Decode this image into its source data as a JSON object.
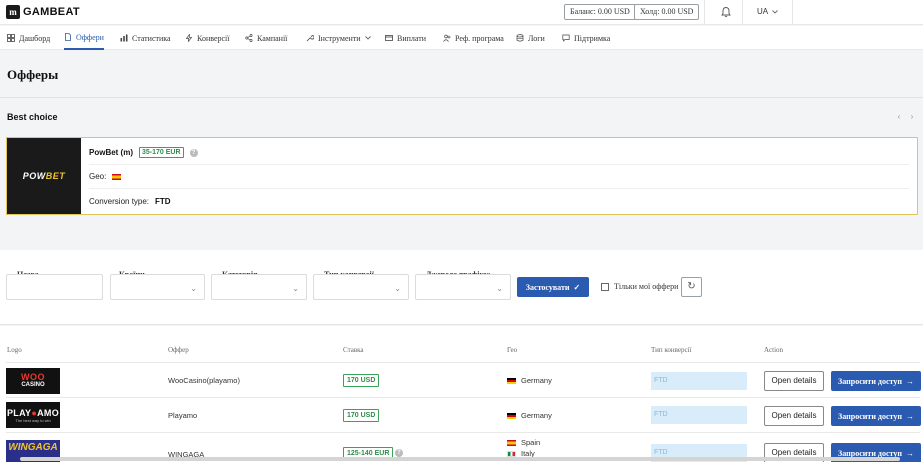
{
  "header": {
    "logo_text": "GAMBEAT",
    "balance": "Баланс: 0.00 USD",
    "hold": "Холд: 0.00 USD",
    "language": "UA"
  },
  "nav": {
    "items": [
      {
        "label": "Дашборд",
        "icon": "grid-icon"
      },
      {
        "label": "Оффери",
        "icon": "document-icon",
        "active": true
      },
      {
        "label": "Статистика",
        "icon": "bar-chart-icon"
      },
      {
        "label": "Конверсії",
        "icon": "bolt-icon"
      },
      {
        "label": "Кампанії",
        "icon": "share-icon"
      },
      {
        "label": "Інструменти",
        "icon": "wrench-icon"
      },
      {
        "label": "Виплати",
        "icon": "card-icon"
      },
      {
        "label": "Реф. програма",
        "icon": "users-icon"
      },
      {
        "label": "Логи",
        "icon": "database-icon"
      },
      {
        "label": "Підтримка",
        "icon": "chat-icon"
      }
    ]
  },
  "page": {
    "title": "Офферы"
  },
  "best_choice": {
    "title": "Best choice",
    "offer_name": "PowBet (m)",
    "rate": "35-170 EUR",
    "geo_label": "Geo:",
    "conversion_label": "Conversion type:",
    "conversion_value": "FTD",
    "brand_logo": "POWBET"
  },
  "filters": {
    "name_label": "Назва",
    "countries_label": "Країни",
    "category_label": "Категорія",
    "conversion_type_label": "Тип конверсії",
    "traffic_source_label": "Джерело трафіку:",
    "apply_label": "Застосувати",
    "only_mine_label": "Тільки мої оффери"
  },
  "table": {
    "headers": [
      "Logo",
      "Оффер",
      "Ставка",
      "Гео",
      "Тип конверсії",
      "Action"
    ],
    "rows": [
      {
        "logo": "WOO CASINO",
        "offer": "WooCasino(playamo)",
        "rate": "170 USD",
        "geo": [
          "Germany"
        ],
        "conversion": "FTD",
        "open": "Open details",
        "request": "Запросити доступ"
      },
      {
        "logo": "PLAY AMO",
        "offer": "Playamo",
        "rate": "170 USD",
        "geo": [
          "Germany"
        ],
        "conversion": "FTD",
        "open": "Open details",
        "request": "Запросити доступ"
      },
      {
        "logo": "WINGAGA",
        "offer": "WINGAGA",
        "rate": "125-140 EUR",
        "geo": [
          "Spain",
          "Italy"
        ],
        "conversion": "FTD",
        "open": "Open details",
        "request": "Запросити доступ"
      }
    ]
  },
  "colors": {
    "accent": "#2b5bb0",
    "green": "#2e8c4a",
    "gold_border": "#e0c65a"
  }
}
